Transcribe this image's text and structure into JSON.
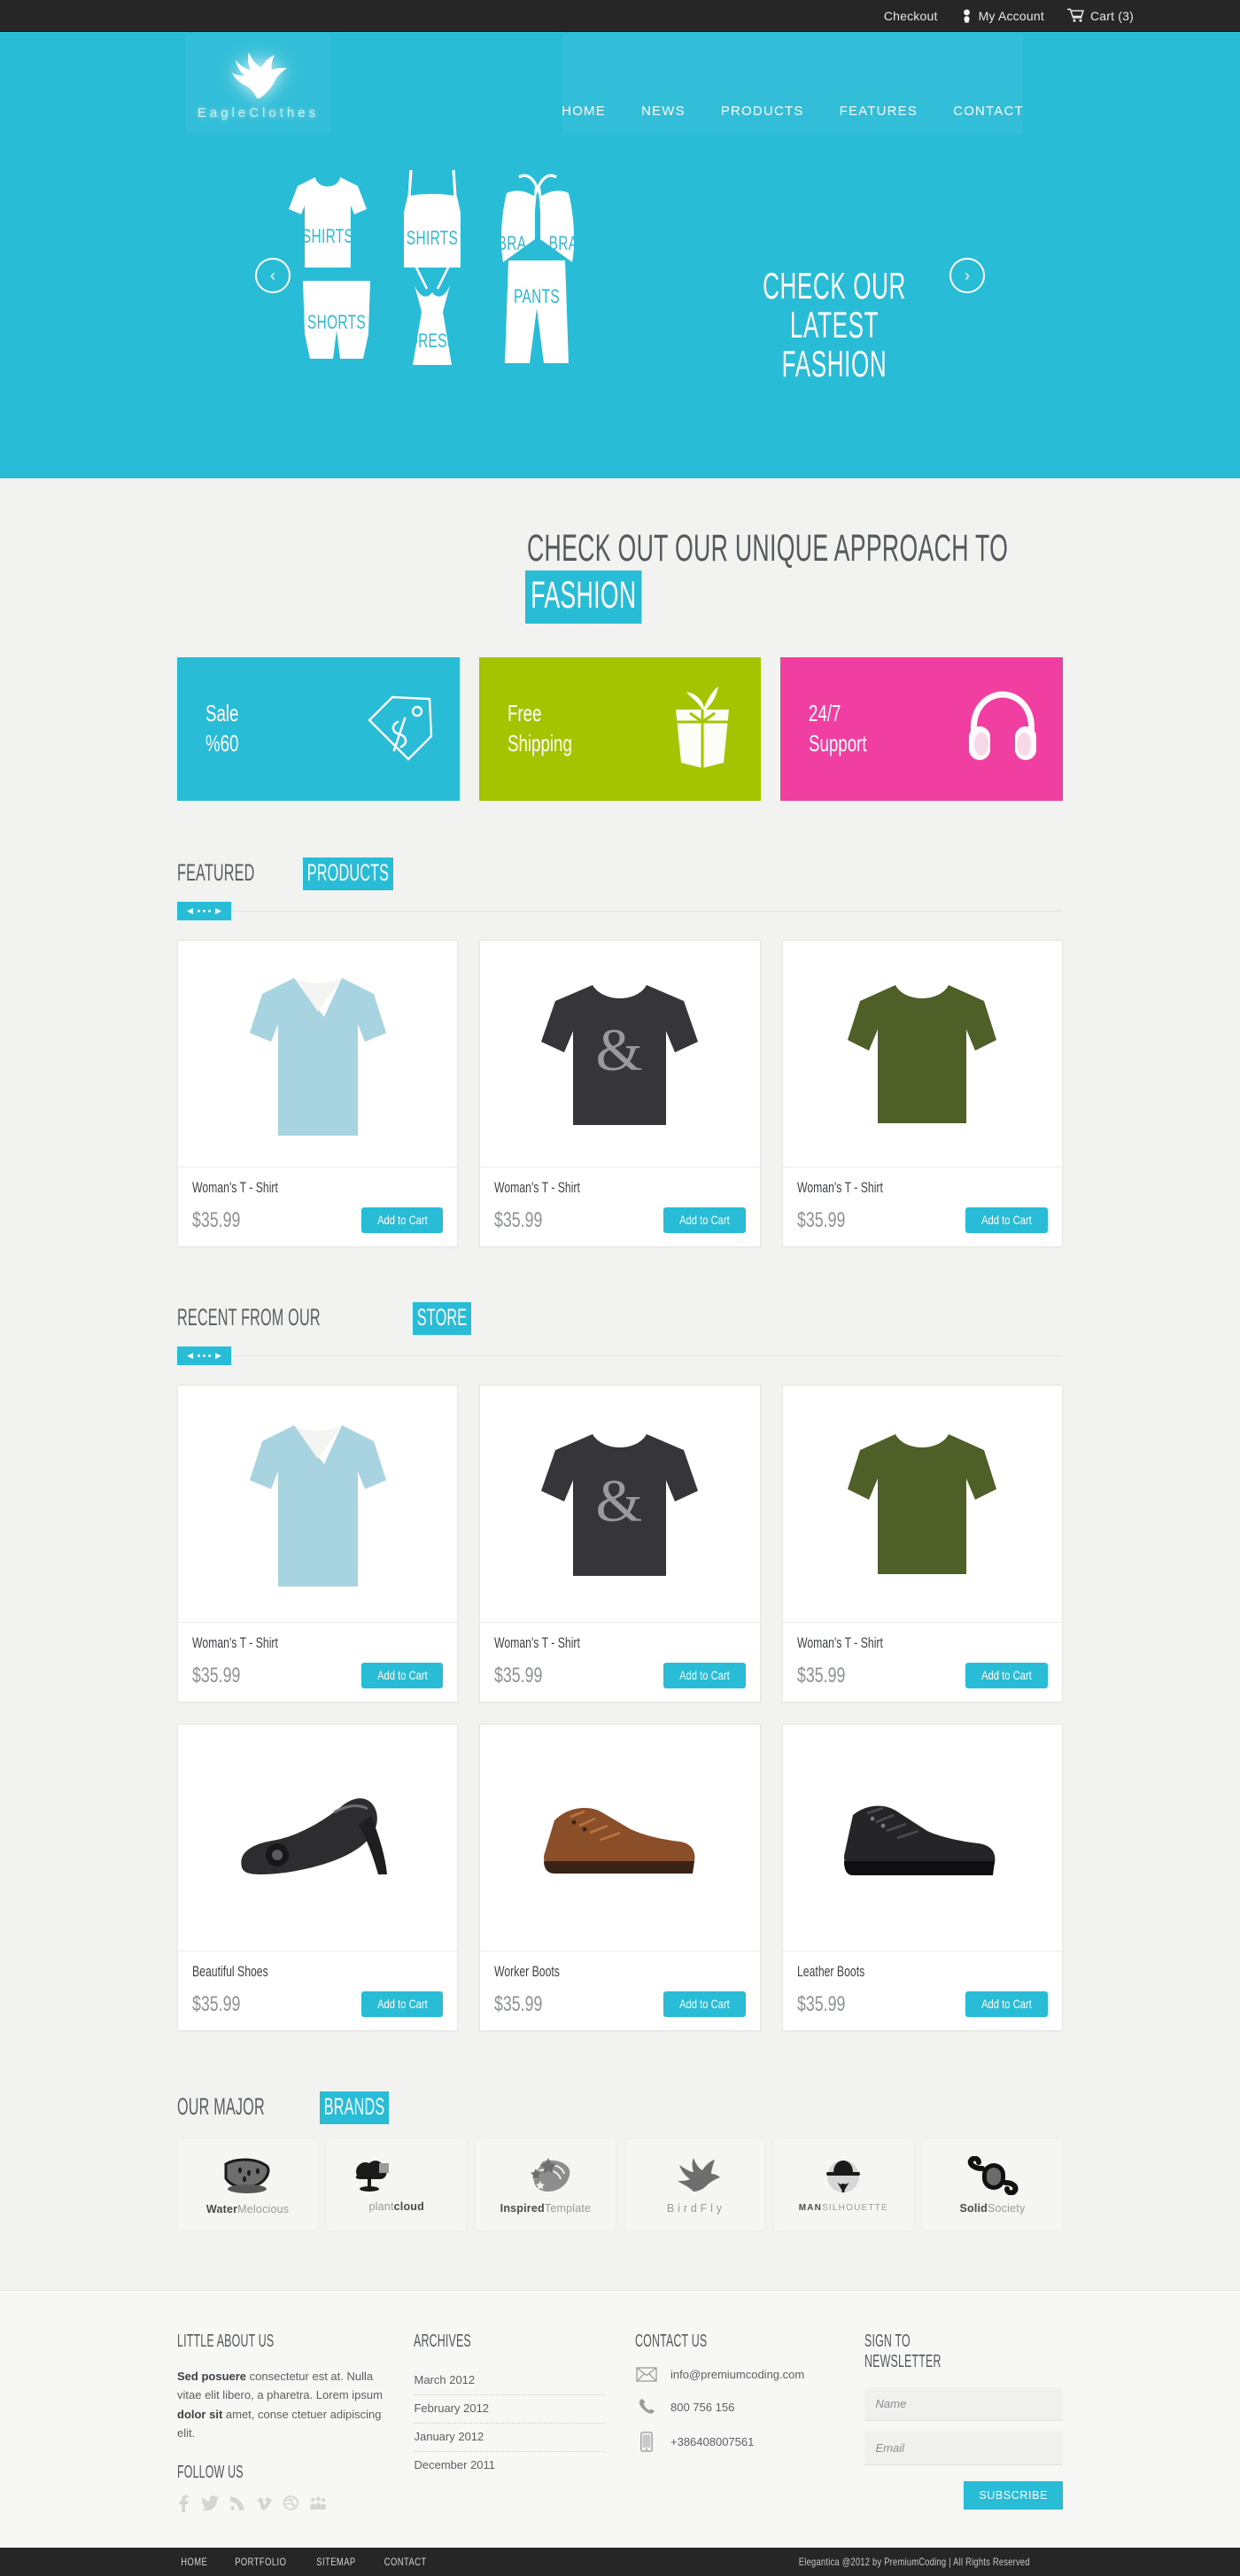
{
  "topbar": {
    "checkout": "Checkout",
    "account": "My Account",
    "cart": "Cart (3)"
  },
  "header": {
    "logo_text": "EagleClothes",
    "nav": [
      {
        "label": "HOME"
      },
      {
        "label": "NEWS"
      },
      {
        "label": "PRODUCTS"
      },
      {
        "label": "FEATURES"
      },
      {
        "label": "CONTACT"
      }
    ]
  },
  "hero": {
    "caption_line1": "CHECK OUR LATEST",
    "caption_line2": "FASHION",
    "prev_label": "‹",
    "next_label": "›",
    "garments": [
      {
        "label": "SHIRTS"
      },
      {
        "label": "SHIRTS"
      },
      {
        "label": "BRA"
      },
      {
        "label": "BRA"
      },
      {
        "label": "SHORTS"
      },
      {
        "label": "DRESS"
      },
      {
        "label": "PANTS"
      }
    ]
  },
  "headline": {
    "plain": "CHECK OUT OUR UNIQUE APPROACH TO",
    "highlight": "FASHION"
  },
  "promos": [
    {
      "text": "Sale\n%60",
      "color": "#29bcd7",
      "icon": "price-tag-icon"
    },
    {
      "text": "Free\nShipping",
      "color": "#a4c400",
      "icon": "gift-box-icon"
    },
    {
      "text": "24/7\nSupport",
      "color": "#f03fa0",
      "icon": "headphones-icon"
    }
  ],
  "featured": {
    "title_plain": "FEATURED",
    "title_highlight": "PRODUCTS",
    "products": [
      {
        "name": "Woman's T - Shirt",
        "price": "$35.99",
        "button": "Add to Cart",
        "image": "tshirt-lightblue"
      },
      {
        "name": "Woman's T - Shirt",
        "price": "$35.99",
        "button": "Add to Cart",
        "image": "tshirt-black-ampersand"
      },
      {
        "name": "Woman's T - Shirt",
        "price": "$35.99",
        "button": "Add to Cart",
        "image": "tshirt-olive"
      }
    ]
  },
  "recent": {
    "title_plain": "RECENT FROM OUR",
    "title_highlight": "STORE",
    "row1": [
      {
        "name": "Woman's T - Shirt",
        "price": "$35.99",
        "button": "Add to Cart",
        "image": "tshirt-lightblue"
      },
      {
        "name": "Woman's T - Shirt",
        "price": "$35.99",
        "button": "Add to Cart",
        "image": "tshirt-black-ampersand"
      },
      {
        "name": "Woman's T - Shirt",
        "price": "$35.99",
        "button": "Add to Cart",
        "image": "tshirt-olive"
      }
    ],
    "row2": [
      {
        "name": "Beautiful Shoes",
        "price": "$35.99",
        "button": "Add to Cart",
        "image": "black-high-heels"
      },
      {
        "name": "Worker Boots",
        "price": "$35.99",
        "button": "Add to Cart",
        "image": "brown-work-boots"
      },
      {
        "name": "Leather Boots",
        "price": "$35.99",
        "button": "Add to Cart",
        "image": "black-leather-boots"
      }
    ]
  },
  "brands": {
    "title_plain": "OUR MAJOR",
    "title_highlight": "BRANDS",
    "items": [
      {
        "name_bold": "Water",
        "name_light": "Melocious",
        "icon": "watermelon-icon"
      },
      {
        "name_bold": "cloud",
        "name_light": "plant",
        "icon": "tree-icon"
      },
      {
        "name_bold": "Inspired",
        "name_light": "Template",
        "icon": "stars-book-icon"
      },
      {
        "name_bold": "",
        "name_light": "B i r d F l y",
        "icon": "bird-icon"
      },
      {
        "name_bold": "MAN",
        "name_light": "SILHOUETTE",
        "icon": "hat-man-icon"
      },
      {
        "name_bold": "Solid",
        "name_light": "Society",
        "icon": "abstract-link-icon"
      }
    ]
  },
  "footer": {
    "about": {
      "heading": "LITTLE ABOUT US",
      "bold1": "Sed posuere",
      "text1": " consectetur  est at. Nulla vitae elit libero, a pharetra. Lorem ipsum ",
      "bold2": "dolor sit",
      "text2": " amet, conse ctetuer adipiscing elit.",
      "follow_heading": "FOLLOW US",
      "social": [
        {
          "name": "facebook-icon"
        },
        {
          "name": "twitter-icon"
        },
        {
          "name": "rss-icon"
        },
        {
          "name": "vimeo-icon"
        },
        {
          "name": "dribbble-icon"
        },
        {
          "name": "myspace-icon"
        }
      ]
    },
    "archives": {
      "heading": "ARCHIVES",
      "items": [
        "March 2012",
        "February 2012",
        "January 2012",
        "December 2011"
      ]
    },
    "contact": {
      "heading": "CONTACT US",
      "email": "info@premiumcoding.com",
      "phone": "800 756 156",
      "mobile": "+386408007561"
    },
    "newsletter": {
      "heading": "SIGN TO NEWSLETTER",
      "name_placeholder": "Name",
      "email_placeholder": "Email",
      "name_value": "",
      "email_value": "",
      "subscribe": "SUBSCRIBE"
    }
  },
  "bottombar": {
    "links": [
      "HOME",
      "PORTFOLIO",
      "SITEMAP",
      "CONTACT"
    ],
    "copyright": "Elegantica @2012 by PremiumCoding | All Rights Reserved"
  },
  "colors": {
    "accent": "#29bcd7",
    "green": "#a4c400",
    "pink": "#f03fa0",
    "dark": "#262626"
  }
}
